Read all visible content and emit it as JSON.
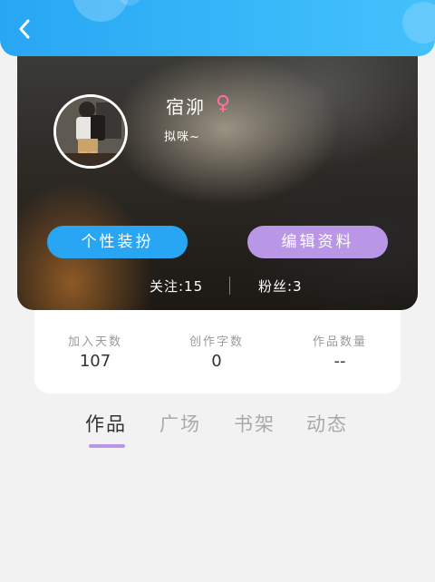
{
  "header": {
    "back_icon": "chevron-left-icon"
  },
  "profile": {
    "nickname": "宿泖",
    "gender_icon": "female-symbol-icon",
    "gender_symbol": "♀",
    "signature": "拟咪~",
    "decorate_label": "个性装扮",
    "edit_label": "编辑资料",
    "follows_text": "关注:15",
    "fans_text": "粉丝:3"
  },
  "stats": {
    "days_label": "加入天数",
    "days_value": "107",
    "words_label": "创作字数",
    "words_value": "0",
    "works_label": "作品数量",
    "works_value": "--"
  },
  "tabs": [
    {
      "label": "作品"
    },
    {
      "label": "广场"
    },
    {
      "label": "书架"
    },
    {
      "label": "动态"
    }
  ],
  "colors": {
    "topbar": "#28a6f4",
    "decorate_button": "#29a6f3",
    "edit_button": "#b997e6",
    "tab_indicator": "#b997e6",
    "gender": "#ff6fa1"
  }
}
